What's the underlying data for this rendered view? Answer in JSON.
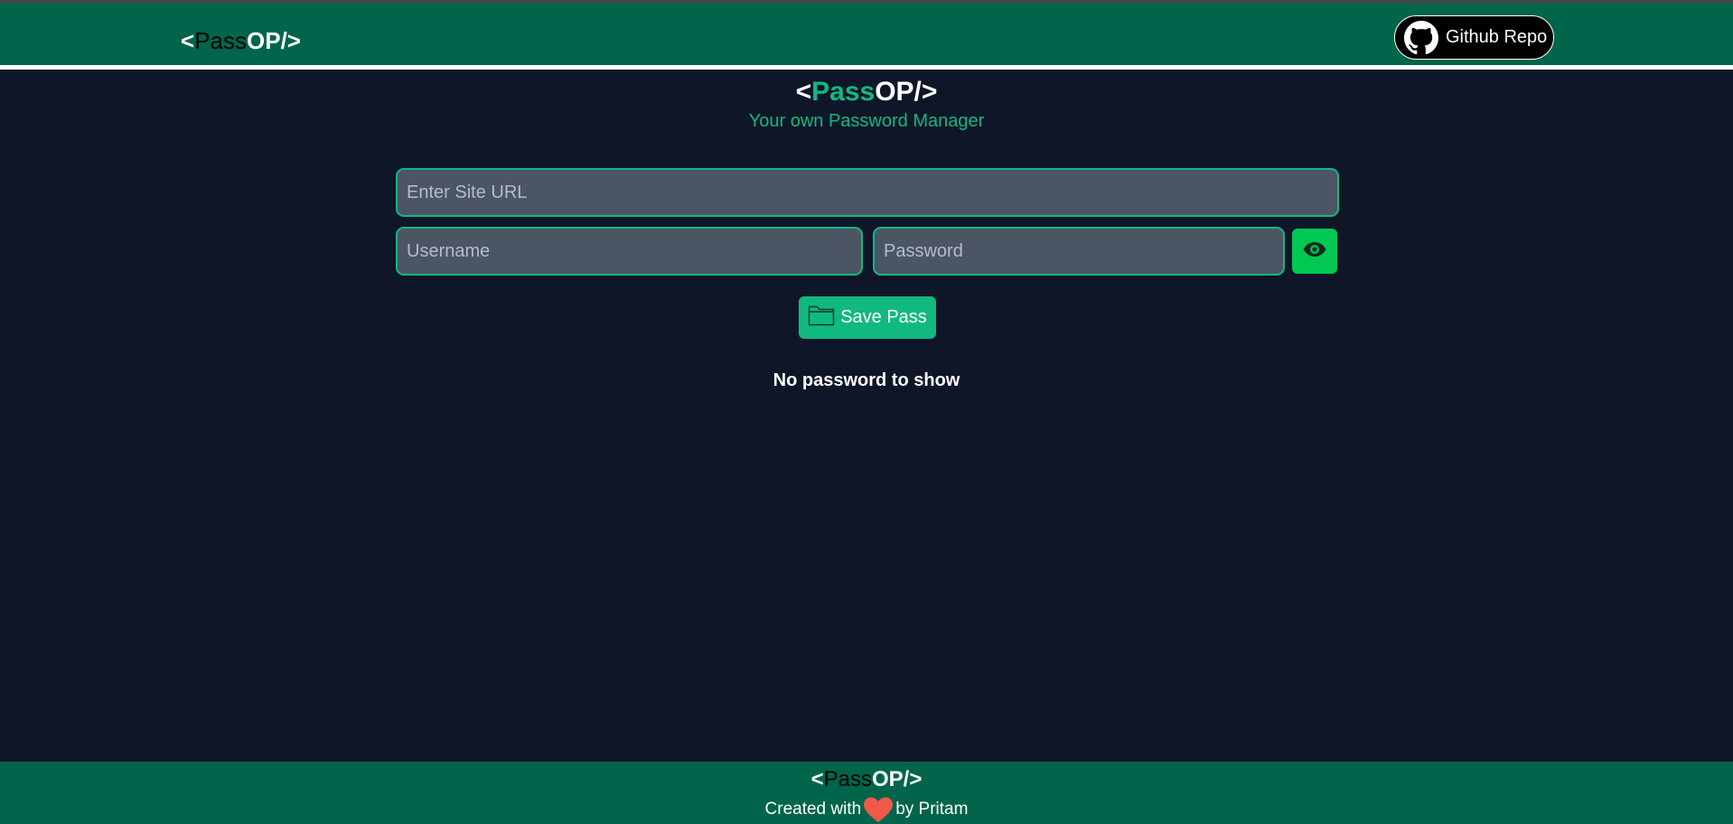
{
  "colors": {
    "nav_bg": "#00654a",
    "page_bg": "#0f1628",
    "accent": "#10b981",
    "eye_button": "#00c853",
    "input_bg": "#4b5563",
    "heart": "#f05a4a"
  },
  "navbar": {
    "logo": {
      "open": "<",
      "pass": "Pass",
      "close": "OP/>"
    },
    "github_button": {
      "label": "Github Repo",
      "icon": "github-icon"
    }
  },
  "header": {
    "logo": {
      "open": "<",
      "pass": "Pass",
      "close": "OP/>"
    },
    "subtitle": "Your own Password Manager"
  },
  "form": {
    "site_url": {
      "placeholder": "Enter Site URL",
      "value": ""
    },
    "username": {
      "placeholder": "Username",
      "value": ""
    },
    "password": {
      "placeholder": "Password",
      "value": ""
    },
    "show_password_icon": "eye-icon",
    "save_button": {
      "label": "Save Pass",
      "icon": "folder-icon"
    }
  },
  "passwords": {
    "empty_message": "No password to show"
  },
  "footer": {
    "logo": {
      "open": "<",
      "pass": "Pass",
      "close": "OP/>"
    },
    "credit_prefix": "Created with",
    "credit_icon": "heart-icon",
    "credit_suffix": "by Pritam"
  }
}
